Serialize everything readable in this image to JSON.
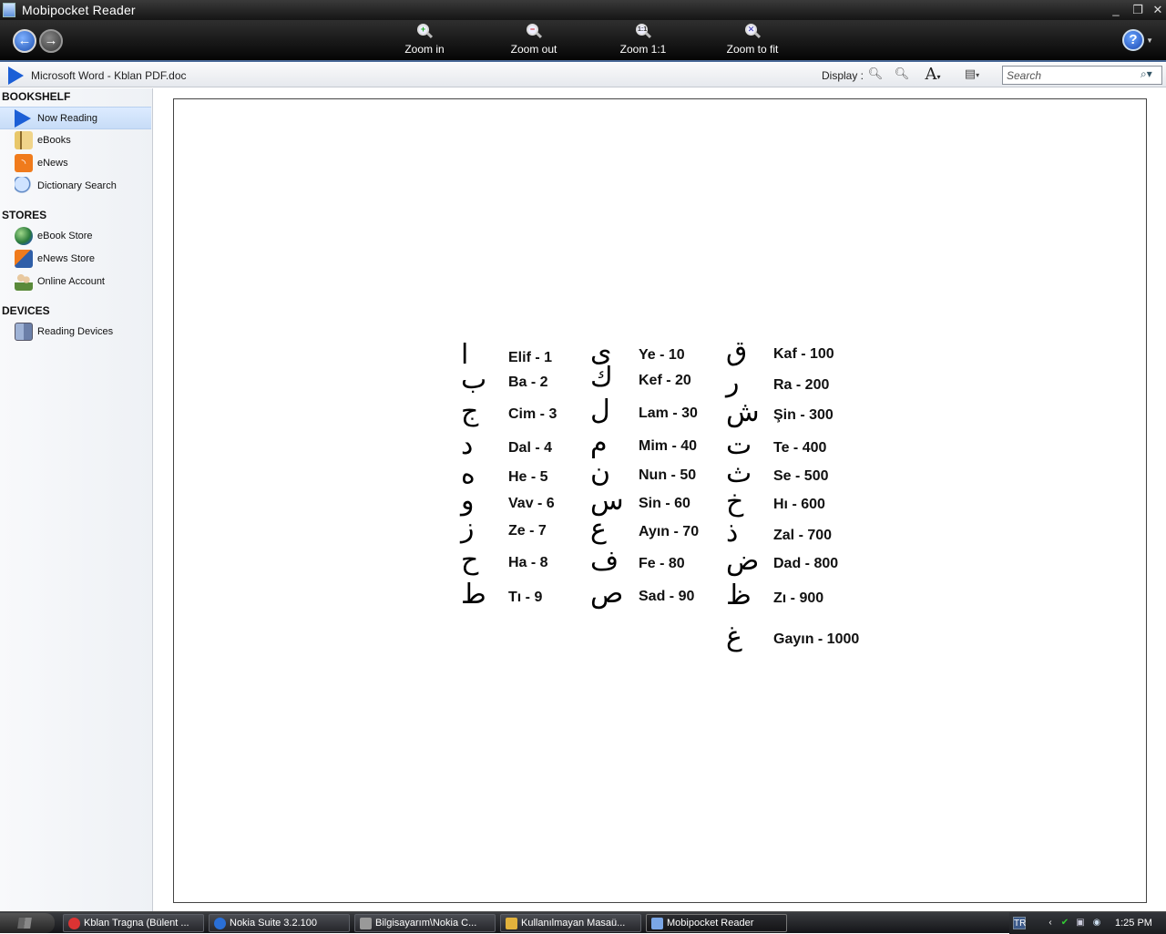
{
  "window": {
    "title": "Mobipocket Reader",
    "controls": [
      "_",
      "❐",
      "✕"
    ]
  },
  "toolbar": {
    "back_glyph": "←",
    "forward_glyph": "→",
    "zoom_in": "Zoom in",
    "zoom_out": "Zoom out",
    "zoom_1_1": "Zoom 1:1",
    "zoom_fit": "Zoom to fit",
    "help_glyph": "?"
  },
  "docbar": {
    "doc_title": "Microsoft Word - Kblan PDF.doc",
    "display_label": "Display :",
    "search_placeholder": "Search"
  },
  "sidebar": {
    "bookshelf_title": "BOOKSHELF",
    "bookshelf": [
      {
        "label": "Now Reading",
        "icon": "play-icon",
        "active": true
      },
      {
        "label": "eBooks",
        "icon": "books-icon"
      },
      {
        "label": "eNews",
        "icon": "rss-icon"
      },
      {
        "label": "Dictionary Search",
        "icon": "magnifier-icon"
      }
    ],
    "stores_title": "STORES",
    "stores": [
      {
        "label": "eBook Store",
        "icon": "globe-icon"
      },
      {
        "label": "eNews Store",
        "icon": "news-store-icon"
      },
      {
        "label": "Online Account",
        "icon": "users-icon"
      }
    ],
    "devices_title": "DEVICES",
    "devices": [
      {
        "label": "Reading Devices",
        "icon": "device-icon"
      }
    ]
  },
  "abjad": [
    {
      "letter": "ا",
      "name": "Elif - 1"
    },
    {
      "letter": "ب",
      "name": "Ba - 2"
    },
    {
      "letter": "ج",
      "name": "Cim - 3"
    },
    {
      "letter": "د",
      "name": "Dal - 4"
    },
    {
      "letter": "ه",
      "name": "He - 5"
    },
    {
      "letter": "و",
      "name": "Vav - 6"
    },
    {
      "letter": "ز",
      "name": "Ze - 7"
    },
    {
      "letter": "ح",
      "name": "Ha - 8"
    },
    {
      "letter": "ط",
      "name": "Tı - 9"
    },
    {
      "letter": "ى",
      "name": "Ye - 10"
    },
    {
      "letter": "ك",
      "name": "Kef - 20"
    },
    {
      "letter": "ل",
      "name": "Lam - 30"
    },
    {
      "letter": "م",
      "name": "Mim - 40"
    },
    {
      "letter": "ن",
      "name": "Nun - 50"
    },
    {
      "letter": "س",
      "name": "Sin - 60"
    },
    {
      "letter": "ع",
      "name": "Ayın - 70"
    },
    {
      "letter": "ف",
      "name": "Fe - 80"
    },
    {
      "letter": "ص",
      "name": "Sad - 90"
    },
    {
      "letter": "ق",
      "name": "Kaf - 100"
    },
    {
      "letter": "ر",
      "name": "Ra - 200"
    },
    {
      "letter": "ش",
      "name": "Şin - 300"
    },
    {
      "letter": "ت",
      "name": "Te - 400"
    },
    {
      "letter": "ث",
      "name": "Se - 500"
    },
    {
      "letter": "خ",
      "name": "Hı - 600"
    },
    {
      "letter": "ذ",
      "name": "Zal - 700"
    },
    {
      "letter": "ض",
      "name": "Dad - 800"
    },
    {
      "letter": "ظ",
      "name": "Zı - 900"
    },
    {
      "letter": "غ",
      "name": "Gayın - 1000"
    }
  ],
  "taskbar": {
    "items": [
      {
        "label": "Kblan Tragna (Bülent ...",
        "icon": "chrome-icon",
        "color": "#d33"
      },
      {
        "label": "Nokia Suite 3.2.100",
        "icon": "nokia-icon",
        "color": "#2a6fd6"
      },
      {
        "label": "Bilgisayarım\\Nokia C...",
        "icon": "drive-icon",
        "color": "#999"
      },
      {
        "label": "Kullanılmayan Masaü...",
        "icon": "folder-icon",
        "color": "#e2b23c"
      },
      {
        "label": "Mobipocket Reader",
        "icon": "mobipocket-icon",
        "color": "#7aa6e6",
        "active": true
      }
    ],
    "lang": "TR",
    "clock": "1:25 PM"
  }
}
